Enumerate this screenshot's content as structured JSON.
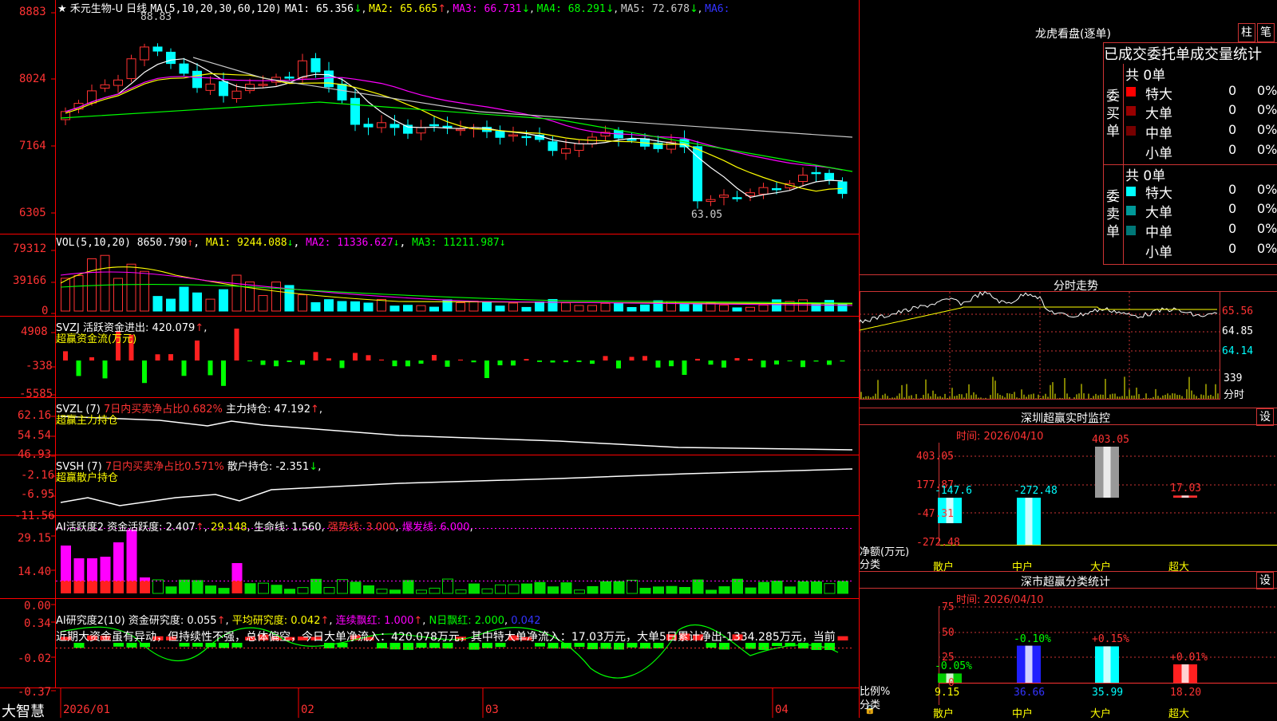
{
  "colors": {
    "up": "#ff3232",
    "down": "#00ffff",
    "ma1": "#ffffff",
    "ma2": "#ffff00",
    "ma3": "#ff00ff",
    "ma4": "#00ff00",
    "ma5": "#c8c8c8",
    "grid": "#ff0000"
  },
  "main": {
    "stock_name": "禾元生物-U",
    "period": "日线",
    "ma_label": "MA(5,10,20,30,60,120)",
    "ma1": "MA1: 65.356",
    "ma2": "MA2: 65.665",
    "ma3": "MA3: 66.731",
    "ma4": "MA4: 68.291",
    "ma5": "MA5: 72.678",
    "ma6": "MA6:",
    "y_ticks": [
      "8883",
      "8024",
      "7164",
      "6305"
    ],
    "high_label": "88.83",
    "low_label": "63.05"
  },
  "vol": {
    "label": "VOL(5,10,20)",
    "value": "8650.790",
    "ma1": "MA1: 9244.088",
    "ma2": "MA2: 11336.627",
    "ma3": "MA3: 11211.987",
    "y_ticks": [
      "79312",
      "39166",
      "0"
    ]
  },
  "svzj": {
    "label": "SVZJ",
    "name": "活跃资金进出: 420.079",
    "sub": "超赢资金流(万元)",
    "y_ticks": [
      "4908",
      "-338",
      "-5585"
    ]
  },
  "svzl": {
    "label": "SVZL (7)",
    "pct": "7日内买卖净占比0.682%",
    "hold": "主力持仓: 47.192",
    "sub": "超赢主力持仓",
    "y_ticks": [
      "62.16",
      "54.54",
      "46.93"
    ]
  },
  "svsh": {
    "label": "SVSH (7)",
    "pct": "7日内买卖净占比0.571%",
    "hold": "散户持仓: -2.351",
    "sub": "超赢散户持仓",
    "y_ticks": [
      "-2.16",
      "-6.95",
      "-11.56"
    ]
  },
  "ai1": {
    "label": "AI活跃度2",
    "a": "资金活跃度: 2.407",
    "b": "29.148",
    "c": "生命线: 1.560",
    "d": "强势线: 3.000",
    "e": "爆发线: 6.000",
    "y_ticks": [
      "29.15",
      "14.40",
      "0.00"
    ]
  },
  "ai2": {
    "label": "AI研究度2(10)",
    "a": "资金研究度: 0.055",
    "b": "平均研究度: 0.042",
    "c": "连续飘红: 1.000",
    "d": "N日飘红: 2.000",
    "e": "0.042",
    "y_ticks": [
      "0.34",
      "-0.02",
      "-0.37"
    ],
    "text": "近期大资金虽有异动，但持续性不强，总体偏空，今日大单净流入：420.078万元，其中特大单净流入：17.03万元，大单5日累计净出-1334.285万元，当前"
  },
  "xaxis": {
    "brand": "大智慧",
    "labels": [
      "2026/01",
      "02",
      "03",
      "04"
    ]
  },
  "lhb": {
    "title": "龙虎看盘(逐单)",
    "btn1": "柱",
    "btn2": "笔",
    "header": "已成交委托单成交量统计",
    "buy_label": "委买单",
    "sell_label": "委卖单",
    "buy_total": "共 0单",
    "sell_total": "共 0单",
    "buy_rows": [
      {
        "name": "特大",
        "count": "0",
        "pct": "0%"
      },
      {
        "name": "大单",
        "count": "0",
        "pct": "0%"
      },
      {
        "name": "中单",
        "count": "0",
        "pct": "0%"
      },
      {
        "name": "小单",
        "count": "0",
        "pct": "0%"
      }
    ],
    "sell_rows": [
      {
        "name": "特大",
        "count": "0",
        "pct": "0%"
      },
      {
        "name": "大单",
        "count": "0",
        "pct": "0%"
      },
      {
        "name": "中单",
        "count": "0",
        "pct": "0%"
      },
      {
        "name": "小单",
        "count": "0",
        "pct": "0%"
      }
    ]
  },
  "intraday": {
    "title": "分时走势",
    "y_ticks": [
      "65.56",
      "64.85",
      "64.14"
    ],
    "vol_tick": "339",
    "unit": "分时"
  },
  "monitor": {
    "title": "深圳超赢实时监控",
    "btn": "设",
    "time": "时间: 2026/04/10",
    "ylabel": "净额(万元)",
    "xlabel": "分类",
    "y_ticks": [
      "403.05",
      "177.87",
      "-47.31",
      "-272.48"
    ]
  },
  "classify": {
    "title": "深市超赢分类统计",
    "btn": "设",
    "time": "时间: 2026/04/10",
    "ylabel": "比例%",
    "xlabel": "分类",
    "y_ticks": [
      "75",
      "50",
      "25",
      "0"
    ]
  },
  "chart_data": [
    {
      "type": "bar",
      "title": "深圳超赢实时监控",
      "categories": [
        "散户",
        "中户",
        "大户",
        "超大"
      ],
      "values": [
        -147.6,
        -272.48,
        403.05,
        17.03
      ],
      "ylim": [
        -272.48,
        403.05
      ]
    },
    {
      "type": "bar",
      "title": "深市超赢分类统计",
      "categories": [
        "散户",
        "中户",
        "大户",
        "超大"
      ],
      "values": [
        9.15,
        36.66,
        35.99,
        18.2
      ],
      "change_labels": [
        "-0.05%",
        "-0.10%",
        "+0.15%",
        "+0.01%"
      ],
      "ylim": [
        0,
        75
      ]
    }
  ]
}
